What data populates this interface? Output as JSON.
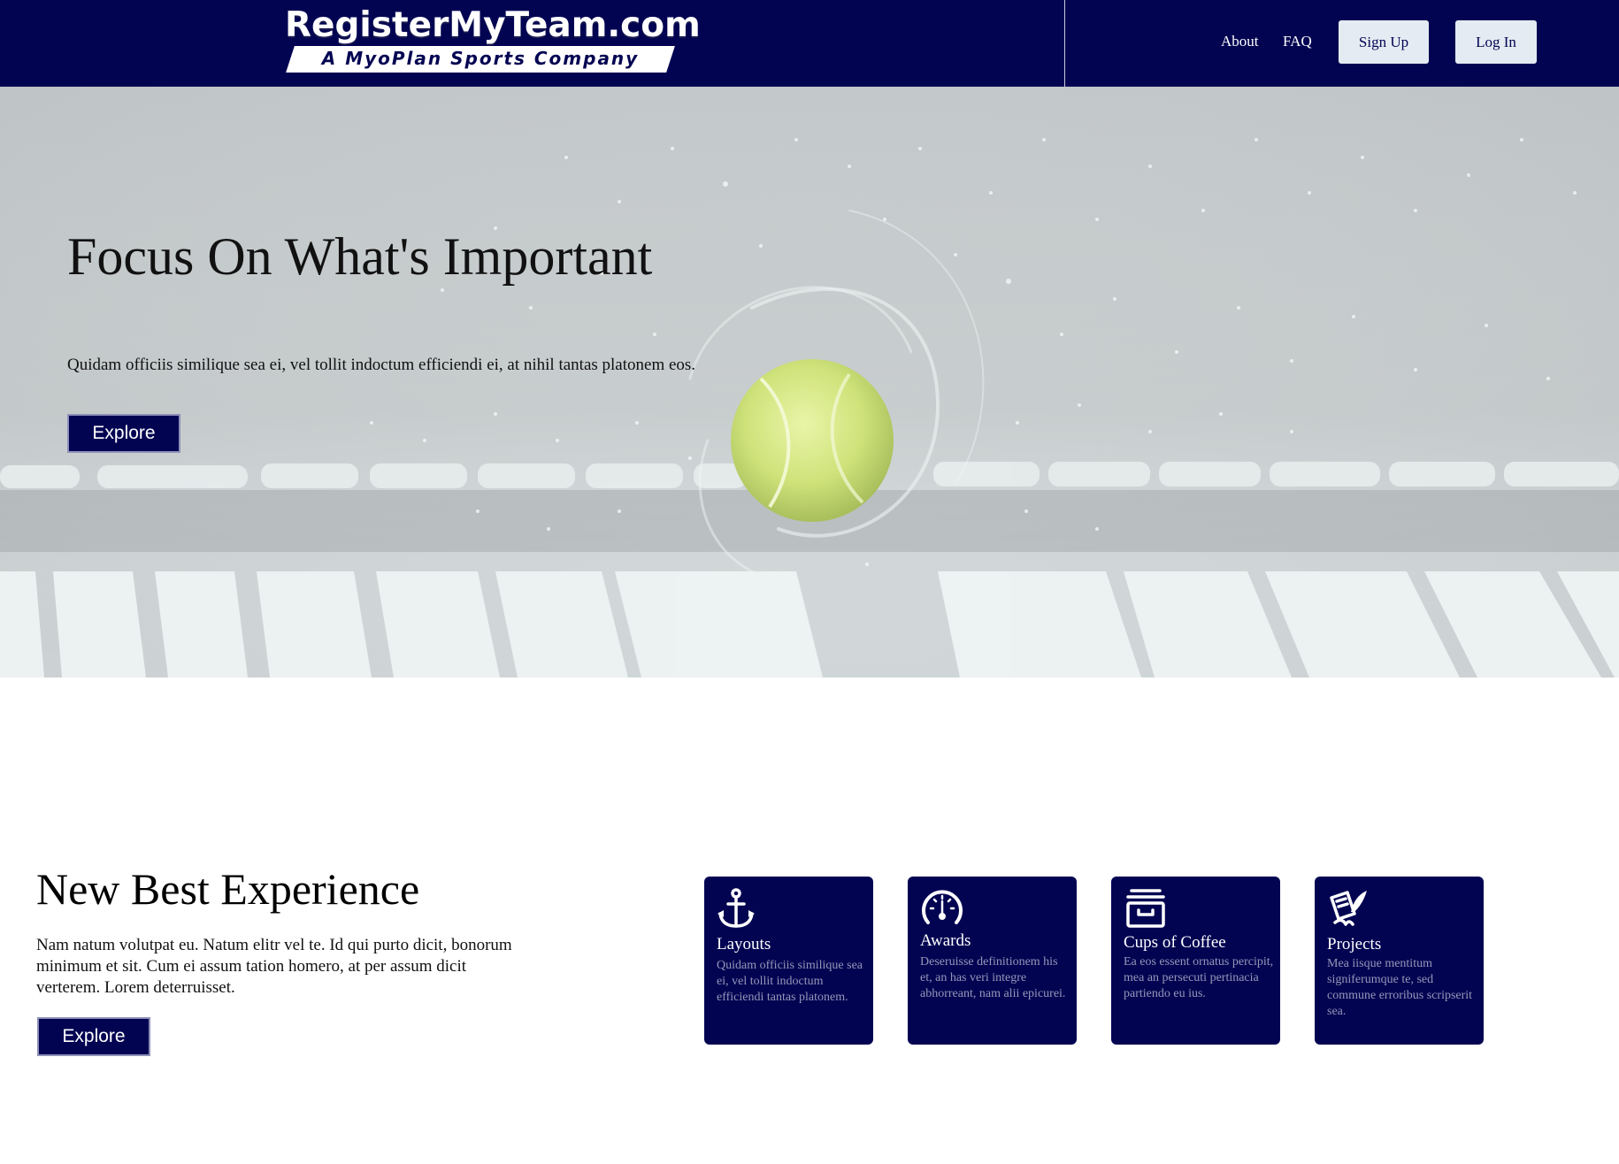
{
  "header": {
    "logo_main": "RegisterMyTeam.com",
    "logo_sub": "A MyoPlan Sports Company",
    "nav": {
      "about": "About",
      "faq": "FAQ"
    },
    "signup_label": "Sign Up",
    "login_label": "Log In"
  },
  "hero": {
    "title": "Focus On What's Important",
    "text": "Quidam officiis similique sea ei, vel tollit indoctum efficiendi ei, at nihil tantas platonem eos.",
    "button": "Explore"
  },
  "section": {
    "title": "New Best Experience",
    "text": "Nam natum volutpat eu. Natum elitr vel te. Id qui purto dicit, bonorum minimum et sit. Cum ei assum tation homero, at per assum dicit verterem. Lorem deterruisset.",
    "button": "Explore"
  },
  "cards": [
    {
      "icon": "anchor-icon",
      "title": "Layouts",
      "text": "Quidam officiis similique sea ei, vel tollit indoctum efficiendi tantas platonem."
    },
    {
      "icon": "dashboard-icon",
      "title": "Awards",
      "text": "Deseruisse definitionem his et, an has veri integre abhorreant, nam alii epicurei."
    },
    {
      "icon": "archive-icon",
      "title": "Cups of Coffee",
      "text": "Ea eos essent ornatus percipit, mea an persecuti pertinacia partiendo eu ius."
    },
    {
      "icon": "contract-icon",
      "title": "Projects",
      "text": "Mea iisque mentitum signiferumque te, sed commune erroribus scripserit sea."
    }
  ],
  "colors": {
    "navy": "#020452",
    "light_button": "#e4ebf2",
    "card_text": "#9597b8"
  }
}
